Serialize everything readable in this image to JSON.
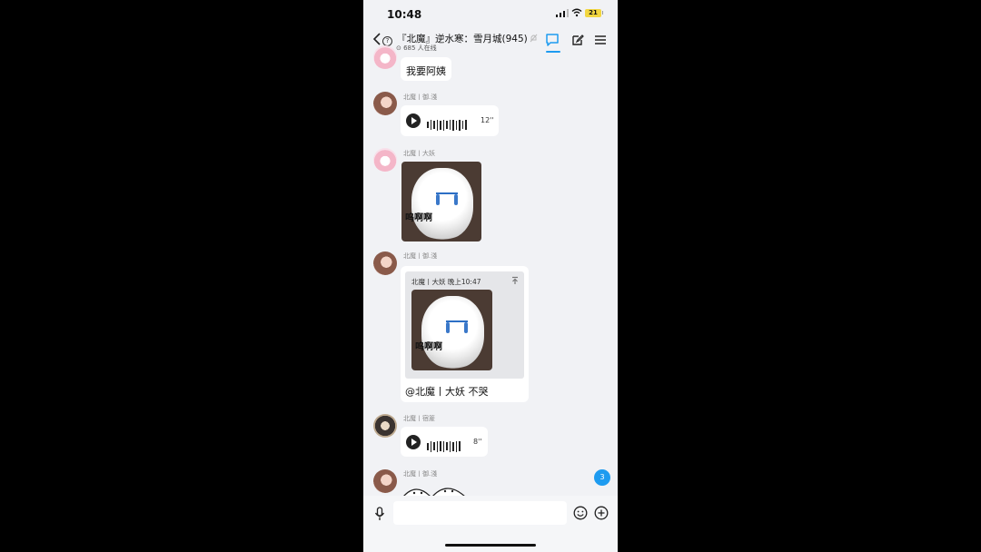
{
  "status_bar": {
    "time": "10:48",
    "battery": "21"
  },
  "header": {
    "title": "『北魔』逆水寒：雪月城(945)",
    "online": "685 人在线"
  },
  "messages": [
    {
      "text": "我要阿姨"
    },
    {
      "sender": "北魔丨御.淺",
      "voice_duration": "12''"
    },
    {
      "sender": "北魔丨大妖",
      "sticker_text": "呜啊啊"
    },
    {
      "sender": "北魔丨御.淺",
      "reply": {
        "header": "北魔丨大妖 晚上10:47",
        "sticker_text": "呜啊啊"
      },
      "text": "@北魔丨大妖 不哭"
    },
    {
      "sender": "北魔丨宿簅",
      "voice_duration": "8''"
    },
    {
      "sender": "北魔丨御.淺"
    }
  ],
  "unread_badge": "3",
  "input": {
    "placeholder": "",
    "value": ""
  },
  "colors": {
    "accent": "#1d9bf0",
    "background": "#f1f2f5"
  },
  "icons": [
    "back-icon",
    "help-icon",
    "chat-icon",
    "edit-icon",
    "menu-icon",
    "play-icon",
    "mic-icon",
    "emoji-icon",
    "plus-icon",
    "pin-icon"
  ]
}
